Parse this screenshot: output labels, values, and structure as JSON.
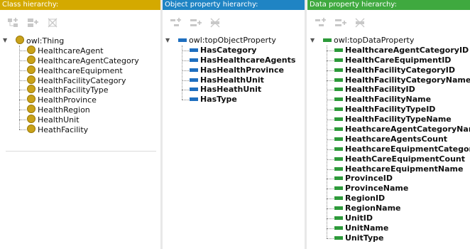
{
  "class_panel": {
    "title": "Class hierarchy:",
    "toolbar": [
      "add-subclass-icon",
      "add-sibling-class-icon",
      "delete-class-icon"
    ],
    "root": "owl:Thing",
    "items": [
      "HealthcareAgent",
      "HealthcareAgentCategory",
      "HealthcareEquipment",
      "HealthFacilityCategory",
      "HealthFacilityType",
      "HealthProvince",
      "HealthRegion",
      "HealthUnit",
      "HeathFacility"
    ]
  },
  "object_panel": {
    "title": "Object property hierarchy:",
    "toolbar": [
      "add-sub-property-icon",
      "add-sibling-property-icon",
      "delete-property-icon"
    ],
    "root": "owl:topObjectProperty",
    "items": [
      "HasCategory",
      "HasHealthcareAgents",
      "HasHealthProvince",
      "HasHealthUnit",
      "HasHeathUnit",
      "HasType"
    ]
  },
  "data_panel": {
    "title": "Data property hierarchy:",
    "toolbar": [
      "add-sub-property-icon",
      "add-sibling-property-icon",
      "delete-property-icon"
    ],
    "root": "owl:topDataProperty",
    "items": [
      "HealthcareAgentCategoryID",
      "HealthCareEquipmentID",
      "HealthFacilityCategoryID",
      "HealthFacilityCategoryName",
      "HealthFacilityID",
      "HealthFacilityName",
      "HealthFacilityTypeID",
      "HealthFacilityTypeName",
      "HeathcareAgentCategoryName",
      "HeathcareAgentsCount",
      "HeathcareEquipmentCategory",
      "HeathCareEquipmentCount",
      "HeathcareEquipmentName",
      "ProvinceID",
      "ProvinceName",
      "RegionID",
      "RegionName",
      "UnitID",
      "UnitName",
      "UnitType"
    ]
  },
  "colors": {
    "class": "#d4a900",
    "object": "#1f84c4",
    "data": "#3fa93f"
  }
}
